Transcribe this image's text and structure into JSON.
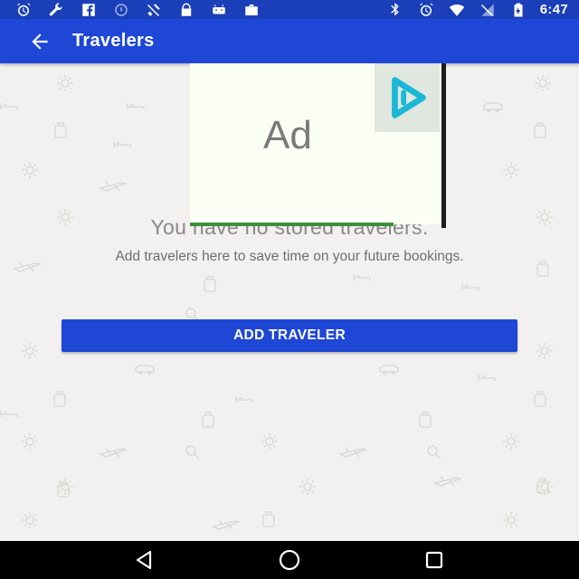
{
  "status_bar": {
    "time": "6:47",
    "left_icons": [
      "alarm-icon",
      "wrench-icon",
      "facebook-icon",
      "circle-icon",
      "signal-off-icon",
      "lock-icon",
      "android-icon",
      "briefcase-icon"
    ],
    "right_icons": [
      "bluetooth-icon",
      "alarm-icon",
      "wifi-icon",
      "no-signal-icon",
      "battery-icon"
    ]
  },
  "app_bar": {
    "title": "Travelers",
    "back_icon": "arrow-left-icon"
  },
  "empty_state": {
    "title": "You have no stored travelers.",
    "subtitle": "Add travelers here to save time on your future bookings."
  },
  "actions": {
    "add_traveler_label": "ADD TRAVELER"
  },
  "ad": {
    "label": "Ad",
    "logo_icon": "play-logo-icon"
  },
  "nav_bar": {
    "buttons": [
      "back-triangle-icon",
      "home-circle-icon",
      "recents-square-icon"
    ]
  },
  "colors": {
    "primary": "#1f47d6",
    "status_bar": "#1a3fb8",
    "background": "#f2f1ef",
    "ad_accent": "#1ab8d6"
  }
}
